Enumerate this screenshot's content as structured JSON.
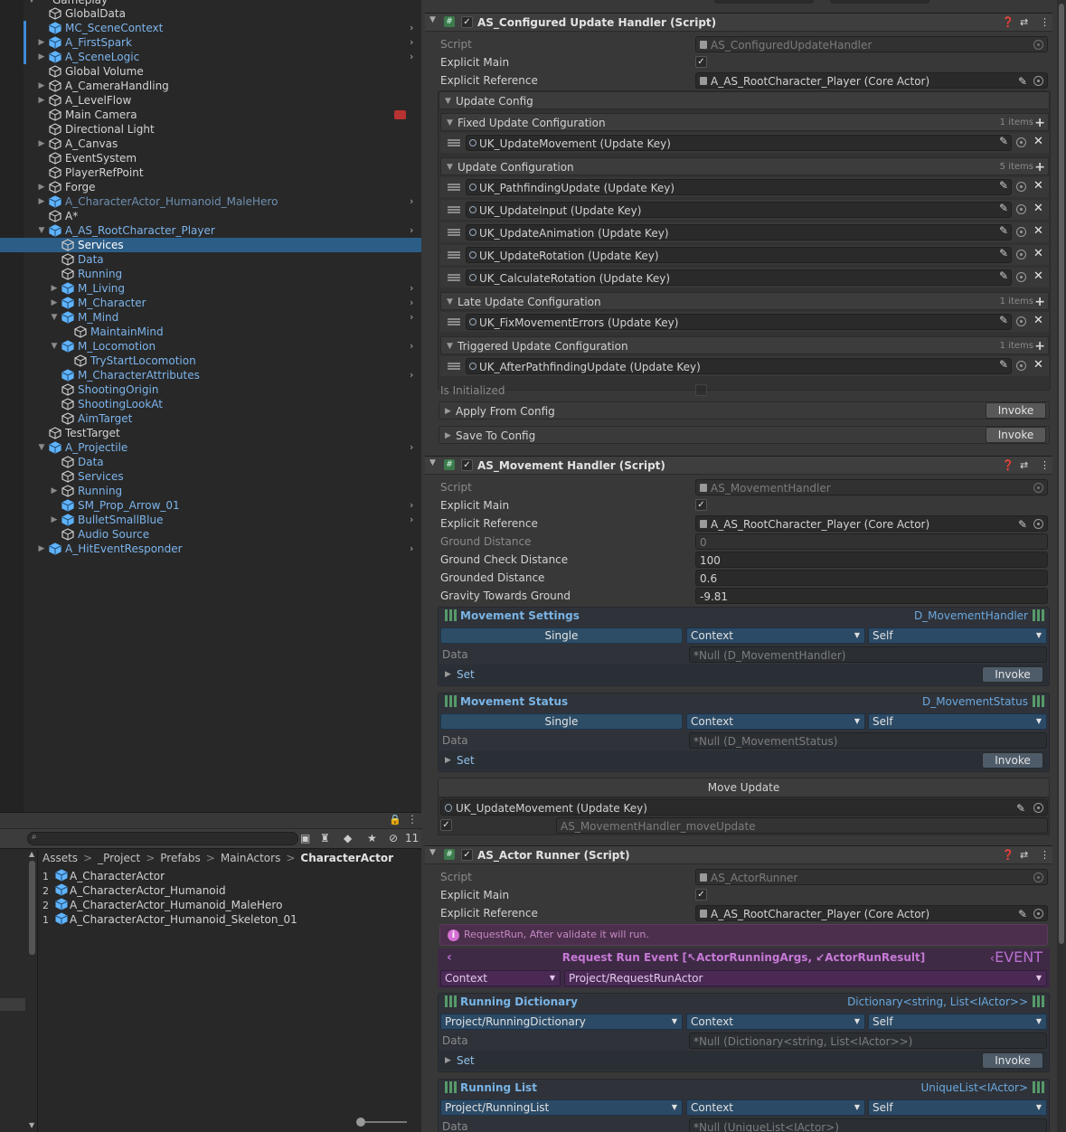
{
  "hierarchy": {
    "top_partial": "Gameplay",
    "items": [
      {
        "label": "GlobalData",
        "depth": 1,
        "arrow": "",
        "prefab": false,
        "blue": false,
        "bar": false,
        "chev": false
      },
      {
        "label": "MC_SceneContext",
        "depth": 1,
        "arrow": "",
        "prefab": true,
        "blue": true,
        "bar": true,
        "chev": true
      },
      {
        "label": "A_FirstSpark",
        "depth": 1,
        "arrow": "▶",
        "prefab": true,
        "blue": true,
        "bar": true,
        "chev": true
      },
      {
        "label": "A_SceneLogic",
        "depth": 1,
        "arrow": "▶",
        "prefab": true,
        "blue": true,
        "bar": true,
        "chev": true
      },
      {
        "label": "Global Volume",
        "depth": 1,
        "arrow": "",
        "prefab": false,
        "blue": false,
        "bar": false,
        "chev": false
      },
      {
        "label": "A_CameraHandling",
        "depth": 1,
        "arrow": "▶",
        "prefab": false,
        "blue": false,
        "bar": false,
        "chev": false
      },
      {
        "label": "A_LevelFlow",
        "depth": 1,
        "arrow": "▶",
        "prefab": false,
        "blue": false,
        "bar": false,
        "chev": false
      },
      {
        "label": "Main Camera",
        "depth": 1,
        "arrow": "",
        "prefab": false,
        "blue": false,
        "bar": false,
        "chev": false,
        "cam": true
      },
      {
        "label": "Directional Light",
        "depth": 1,
        "arrow": "",
        "prefab": false,
        "blue": false,
        "bar": false,
        "chev": false
      },
      {
        "label": "A_Canvas",
        "depth": 1,
        "arrow": "▶",
        "prefab": false,
        "blue": false,
        "bar": false,
        "chev": false
      },
      {
        "label": "EventSystem",
        "depth": 1,
        "arrow": "",
        "prefab": false,
        "blue": false,
        "bar": false,
        "chev": false
      },
      {
        "label": "PlayerRefPoint",
        "depth": 1,
        "arrow": "",
        "prefab": false,
        "blue": false,
        "bar": false,
        "chev": false
      },
      {
        "label": "Forge",
        "depth": 1,
        "arrow": "▶",
        "prefab": false,
        "blue": false,
        "bar": false,
        "chev": false
      },
      {
        "label": "A_CharacterActor_Humanoid_MaleHero",
        "depth": 1,
        "arrow": "▶",
        "prefab": true,
        "blue": true,
        "bar": false,
        "chev": true,
        "faded": true
      },
      {
        "label": "A*",
        "depth": 1,
        "arrow": "",
        "prefab": false,
        "blue": false,
        "bar": false,
        "chev": false
      },
      {
        "label": "A_AS_RootCharacter_Player",
        "depth": 1,
        "arrow": "▼",
        "prefab": true,
        "blue": true,
        "bar": false,
        "chev": true
      },
      {
        "label": "Services",
        "depth": 2,
        "arrow": "",
        "prefab": false,
        "blue": false,
        "bar": false,
        "chev": false,
        "sel": true
      },
      {
        "label": "Data",
        "depth": 2,
        "arrow": "",
        "prefab": false,
        "blue": true,
        "bar": false,
        "chev": false
      },
      {
        "label": "Running",
        "depth": 2,
        "arrow": "",
        "prefab": false,
        "blue": true,
        "bar": false,
        "chev": false
      },
      {
        "label": "M_Living",
        "depth": 2,
        "arrow": "▶",
        "prefab": true,
        "blue": true,
        "bar": false,
        "chev": true
      },
      {
        "label": "M_Character",
        "depth": 2,
        "arrow": "▶",
        "prefab": true,
        "blue": true,
        "bar": false,
        "chev": true
      },
      {
        "label": "M_Mind",
        "depth": 2,
        "arrow": "▼",
        "prefab": true,
        "blue": true,
        "bar": false,
        "chev": true
      },
      {
        "label": "MaintainMind",
        "depth": 3,
        "arrow": "",
        "prefab": false,
        "blue": true,
        "bar": false,
        "chev": false
      },
      {
        "label": "M_Locomotion",
        "depth": 2,
        "arrow": "▼",
        "prefab": true,
        "blue": true,
        "bar": false,
        "chev": true
      },
      {
        "label": "TryStartLocomotion",
        "depth": 3,
        "arrow": "",
        "prefab": false,
        "blue": true,
        "bar": false,
        "chev": false
      },
      {
        "label": "M_CharacterAttributes",
        "depth": 2,
        "arrow": "",
        "prefab": true,
        "blue": true,
        "bar": false,
        "chev": true
      },
      {
        "label": "ShootingOrigin",
        "depth": 2,
        "arrow": "",
        "prefab": false,
        "blue": true,
        "bar": false,
        "chev": false
      },
      {
        "label": "ShootingLookAt",
        "depth": 2,
        "arrow": "",
        "prefab": false,
        "blue": true,
        "bar": false,
        "chev": false
      },
      {
        "label": "AimTarget",
        "depth": 2,
        "arrow": "",
        "prefab": false,
        "blue": true,
        "bar": false,
        "chev": false
      },
      {
        "label": "TestTarget",
        "depth": 1,
        "arrow": "",
        "prefab": false,
        "blue": false,
        "bar": false,
        "chev": false
      },
      {
        "label": "A_Projectile",
        "depth": 1,
        "arrow": "▼",
        "prefab": true,
        "blue": true,
        "bar": false,
        "chev": true
      },
      {
        "label": "Data",
        "depth": 2,
        "arrow": "",
        "prefab": false,
        "blue": true,
        "bar": false,
        "chev": false
      },
      {
        "label": "Services",
        "depth": 2,
        "arrow": "",
        "prefab": false,
        "blue": true,
        "bar": false,
        "chev": false
      },
      {
        "label": "Running",
        "depth": 2,
        "arrow": "▶",
        "prefab": false,
        "blue": true,
        "bar": false,
        "chev": false
      },
      {
        "label": "SM_Prop_Arrow_01",
        "depth": 2,
        "arrow": "",
        "prefab": true,
        "blue": true,
        "bar": false,
        "chev": true
      },
      {
        "label": "BulletSmallBlue",
        "depth": 2,
        "arrow": "▶",
        "prefab": true,
        "blue": true,
        "bar": false,
        "chev": true
      },
      {
        "label": "Audio Source",
        "depth": 2,
        "arrow": "",
        "prefab": false,
        "blue": true,
        "bar": false,
        "chev": false
      },
      {
        "label": "A_HitEventResponder",
        "depth": 1,
        "arrow": "▶",
        "prefab": true,
        "blue": true,
        "bar": false,
        "chev": true
      }
    ]
  },
  "project": {
    "hidden_count": "11",
    "breadcrumb": [
      "Assets",
      "_Project",
      "Prefabs",
      "MainActors",
      "CharacterActor"
    ],
    "items": [
      {
        "count": "1",
        "label": "A_CharacterActor"
      },
      {
        "count": "2",
        "label": "A_CharacterActor_Humanoid"
      },
      {
        "count": "2",
        "label": "A_CharacterActor_Humanoid_MaleHero"
      },
      {
        "count": "1",
        "label": "A_CharacterActor_Humanoid_Skeleton_01"
      }
    ]
  },
  "comp1": {
    "title": "AS_Configured Update Handler (Script)",
    "script_label": "Script",
    "script_value": "AS_ConfiguredUpdateHandler",
    "main_label": "Explicit Main",
    "ref_label": "Explicit Reference",
    "ref_value": "A_AS_RootCharacter_Player (Core Actor)",
    "update_config": "Update Config",
    "fixed": {
      "title": "Fixed Update Configuration",
      "count": "1 items",
      "keys": [
        "UK_UpdateMovement (Update Key)"
      ]
    },
    "update": {
      "title": "Update Configuration",
      "count": "5 items",
      "keys": [
        "UK_PathfindingUpdate (Update Key)",
        "UK_UpdateInput (Update Key)",
        "UK_UpdateAnimation (Update Key)",
        "UK_UpdateRotation (Update Key)",
        "UK_CalculateRotation (Update Key)"
      ]
    },
    "late": {
      "title": "Late Update Configuration",
      "count": "1 items",
      "keys": [
        "UK_FixMovementErrors (Update Key)"
      ]
    },
    "triggered": {
      "title": "Triggered Update Configuration",
      "count": "1 items",
      "keys": [
        "UK_AfterPathfindingUpdate (Update Key)"
      ]
    },
    "initialized": "Is Initialized",
    "apply": "Apply From Config",
    "save": "Save To Config",
    "invoke": "Invoke"
  },
  "comp2": {
    "title": "AS_Movement Handler (Script)",
    "script_label": "Script",
    "script_value": "AS_MovementHandler",
    "main_label": "Explicit Main",
    "ref_label": "Explicit Reference",
    "ref_value": "A_AS_RootCharacter_Player (Core Actor)",
    "gd_label": "Ground Distance",
    "gd_value": "0",
    "gcd_label": "Ground Check Distance",
    "gcd_value": "100",
    "grd_label": "Grounded Distance",
    "grd_value": "0.6",
    "grav_label": "Gravity Towards Ground",
    "grav_value": "-9.81",
    "settings": {
      "title": "Movement Settings",
      "type": "D_MovementHandler",
      "mode": "Single",
      "ctx": "Context",
      "self": "Self",
      "data_label": "Data",
      "data_value": "Null (D_MovementHandler)",
      "set": "Set",
      "invoke": "Invoke"
    },
    "status": {
      "title": "Movement Status",
      "type": "D_MovementStatus",
      "mode": "Single",
      "ctx": "Context",
      "self": "Self",
      "data_label": "Data",
      "data_value": "Null (D_MovementStatus)",
      "set": "Set",
      "invoke": "Invoke"
    },
    "move_update": "Move Update",
    "move_key": "UK_UpdateMovement (Update Key)",
    "move_sub": "AS_MovementHandler_moveUpdate"
  },
  "comp3": {
    "title": "AS_Actor Runner (Script)",
    "script_label": "Script",
    "script_value": "AS_ActorRunner",
    "main_label": "Explicit Main",
    "ref_label": "Explicit Reference",
    "ref_value": "A_AS_RootCharacter_Player (Core Actor)",
    "info": "RequestRun, After validate it will run.",
    "event_title": "Request Run Event [↖ActorRunningArgs, ↙ActorRunResult]",
    "event_tag": "EVENT",
    "event_ctx": "Context",
    "event_path": "Project/RequestRunActor",
    "dict": {
      "title": "Running Dictionary",
      "type": "Dictionary<string, List<IActor>>",
      "path": "Project/RunningDictionary",
      "ctx": "Context",
      "self": "Self",
      "data_label": "Data",
      "data_value": "Null (Dictionary<string, List<IActor>>)",
      "set": "Set",
      "invoke": "Invoke"
    },
    "list": {
      "title": "Running List",
      "type": "UniqueList<IActor>",
      "path": "Project/RunningList",
      "ctx": "Context",
      "self": "Self",
      "data_label": "Data",
      "data_value": "Null (UniqueList<IActor>)"
    }
  }
}
